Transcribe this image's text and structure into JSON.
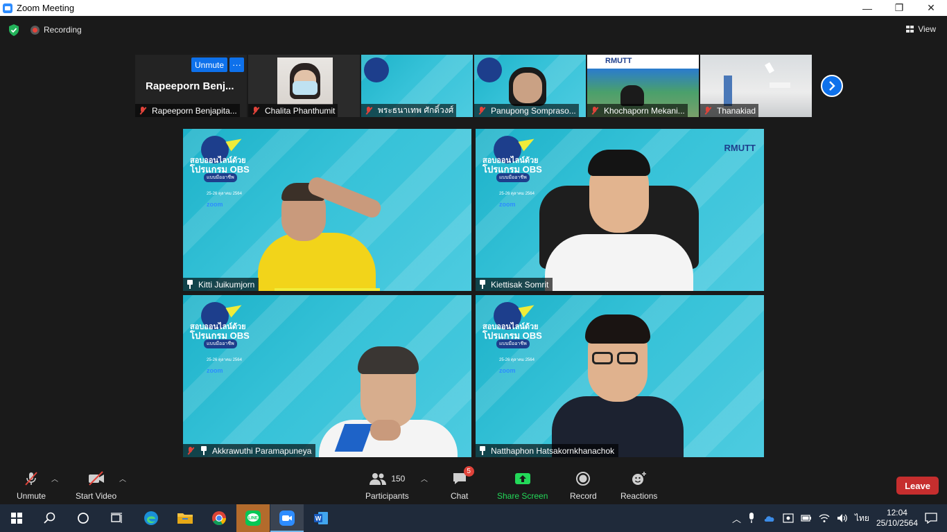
{
  "window": {
    "title": "Zoom Meeting",
    "controls": [
      "—",
      "❐",
      "✕"
    ]
  },
  "topbar": {
    "recording_label": "Recording",
    "view_label": "View"
  },
  "strip": {
    "self_name": "Rapeeporn  Benj...",
    "unmute_label": "Unmute",
    "more_label": "···",
    "thumbnails": [
      {
        "name": "Rapeeporn Benjapita..."
      },
      {
        "name": "Chalita Phanthumit"
      },
      {
        "name": "พระธนาเทพ ศักดิ์วงศ์"
      },
      {
        "name": "Panupong Somprasо..."
      },
      {
        "name": "Khochaporn Mekani..."
      },
      {
        "name": "Thanakiad"
      }
    ]
  },
  "obs_banner": {
    "line1": "สอบออนไลน์ด้วย",
    "line2": "โปรแกรม OBS",
    "line3": "แบบมืออาชีพ",
    "dates": "25-26 ตุลาคม 2564",
    "zoom": "zoom",
    "rmutt": "RMUTT"
  },
  "tiles": [
    {
      "name": "Kitti Juikumjorn"
    },
    {
      "name": "Kiettisak Somrit"
    },
    {
      "name": "Akkrawuthi Paramapuneya"
    },
    {
      "name": "Natthaphon Hatsakornkhanachok"
    }
  ],
  "toolbar": {
    "unmute": "Unmute",
    "start_video": "Start Video",
    "participants": "Participants",
    "participants_count": "150",
    "chat": "Chat",
    "chat_badge": "5",
    "share_screen": "Share Screen",
    "record": "Record",
    "reactions": "Reactions",
    "leave": "Leave"
  },
  "taskbar": {
    "lang": "ไทย",
    "time": "12:04",
    "date": "25/10/2564"
  },
  "colors": {
    "accent": "#0e71eb",
    "share_green": "#23d959",
    "leave_red": "#c62e2e",
    "muted_red": "#e0433a",
    "speaker_yellow": "#f0ec39"
  }
}
